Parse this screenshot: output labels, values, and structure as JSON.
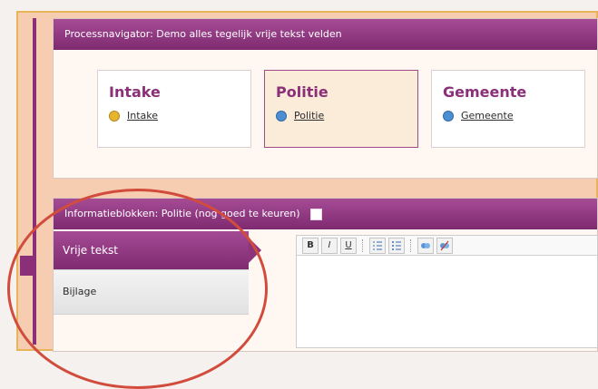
{
  "process_navigator": {
    "header": "Processnavigator: Demo alles tegelijk vrije tekst velden",
    "cards": [
      {
        "title": "Intake",
        "link": "Intake",
        "status_color": "#e7b52d"
      },
      {
        "title": "Politie",
        "link": "Politie",
        "status_color": "#4b8fd2"
      },
      {
        "title": "Gemeente",
        "link": "Gemeente",
        "status_color": "#4b8fd2"
      }
    ]
  },
  "info_blocks": {
    "header": "Informatieblokken: Politie (nog goed te keuren)",
    "tabs": [
      {
        "label": "Vrije tekst",
        "active": true
      },
      {
        "label": "Bijlage",
        "active": false
      }
    ]
  },
  "editor": {
    "toolbar": {
      "bold": "B",
      "italic": "I",
      "underline": "U"
    }
  }
}
